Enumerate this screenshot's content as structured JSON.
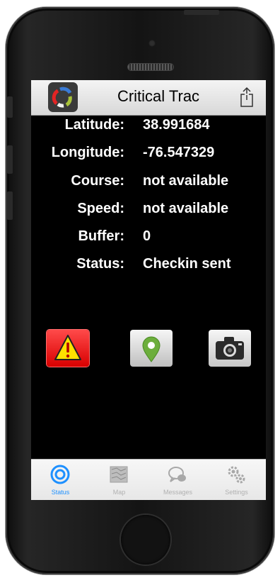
{
  "app": {
    "title": "Critical Trac"
  },
  "status_fields": [
    {
      "label": "Latitude:",
      "value": "38.991684"
    },
    {
      "label": "Longitude:",
      "value": "-76.547329"
    },
    {
      "label": "Course:",
      "value": "not available"
    },
    {
      "label": "Speed:",
      "value": "not available"
    },
    {
      "label": "Buffer:",
      "value": "0"
    },
    {
      "label": "Status:",
      "value": "Checkin sent"
    }
  ],
  "actions": [
    {
      "icon": "warning-icon",
      "color": "#e60000"
    },
    {
      "icon": "map-pin-icon",
      "color": "#6cae3c"
    },
    {
      "icon": "camera-icon",
      "color": "#2b2b2b"
    }
  ],
  "tabs": [
    {
      "label": "Status",
      "icon": "target-icon",
      "active": true
    },
    {
      "label": "Map",
      "icon": "map-icon",
      "active": false
    },
    {
      "label": "Messages",
      "icon": "chat-icon",
      "active": false
    },
    {
      "label": "Settings",
      "icon": "gears-icon",
      "active": false
    }
  ],
  "colors": {
    "accent": "#1e90ff",
    "tab_inactive": "#b0b0b0",
    "screen_bg": "#000000",
    "text": "#ffffff"
  }
}
